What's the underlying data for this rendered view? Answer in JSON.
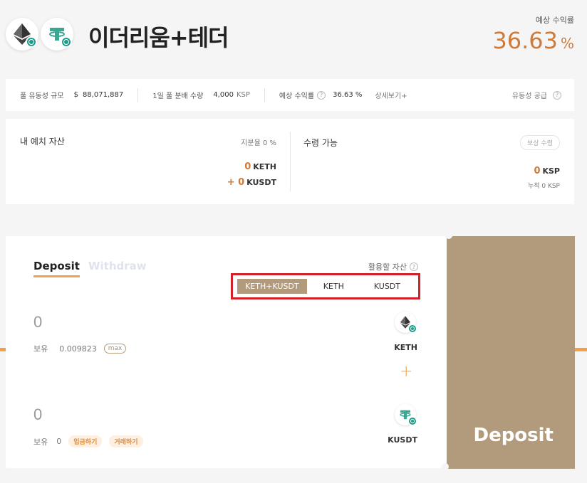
{
  "header": {
    "title": "이더리움+테더",
    "apr_label": "예상 수익률",
    "apr_value": "36.63",
    "apr_unit": "%"
  },
  "stats": {
    "liquidity_label": "풀 유동성 규모",
    "liquidity_currency": "$",
    "liquidity_value": "88,071,887",
    "daily_dist_label": "1일 풀 분배 수량",
    "daily_dist_value": "4,000",
    "daily_dist_unit": "KSP",
    "apr_label": "예상 수익률",
    "apr_value": "36.63 %",
    "detail_link": "상세보기+",
    "supply_label": "유동성 공급"
  },
  "my_assets": {
    "title": "내 예치 자산",
    "share_label": "지분율 0 %",
    "keth_amount": "0",
    "keth_unit": "KETH",
    "kusdt_amount": "+ 0",
    "kusdt_unit": "KUSDT"
  },
  "claim": {
    "title": "수령 가능",
    "button_label": "보상 수령",
    "ksp_amount": "0",
    "ksp_unit": "KSP",
    "accumulated": "누적 0 KSP"
  },
  "trade": {
    "tab_deposit": "Deposit",
    "tab_withdraw": "Withdraw",
    "usable_label": "활용할 자산",
    "segments": [
      "KETH+KUSDT",
      "KETH",
      "KUSDT"
    ],
    "keth_input": "0",
    "keth_hold_label": "보유",
    "keth_hold_value": "0.009823",
    "max_label": "max",
    "keth_name": "KETH",
    "kusdt_input": "0",
    "kusdt_hold_label": "보유",
    "kusdt_hold_value": "0",
    "deposit_pill": "입금하기",
    "trade_pill": "거래하기",
    "kusdt_name": "KUSDT"
  },
  "deposit_panel": {
    "label": "Deposit"
  },
  "colors": {
    "accent": "#d07a3a",
    "brand_tan": "#b29b7c",
    "orange_line": "#f2a04a",
    "highlight": "#d3212a",
    "usdt_teal": "#1e9c8a"
  },
  "icons": [
    "ethereum-icon",
    "tether-icon",
    "help-icon",
    "plus-icon"
  ]
}
